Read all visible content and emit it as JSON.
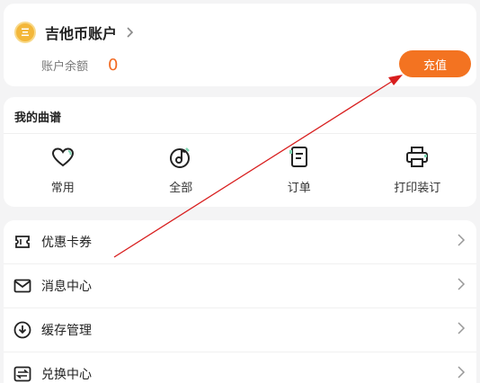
{
  "account": {
    "title": "吉他币账户",
    "balance_label": "账户余额",
    "balance_value": "0",
    "recharge_label": "充值",
    "coin_icon": "guitar-coin-icon",
    "accent_color": "#f37321"
  },
  "my_scores": {
    "title": "我的曲谱",
    "items": [
      {
        "label": "常用",
        "icon": "heart-icon"
      },
      {
        "label": "全部",
        "icon": "music-note-icon"
      },
      {
        "label": "订单",
        "icon": "order-icon"
      },
      {
        "label": "打印装订",
        "icon": "printer-icon"
      }
    ]
  },
  "menu": {
    "items": [
      {
        "label": "优惠卡券",
        "icon": "coupon-icon"
      },
      {
        "label": "消息中心",
        "icon": "mail-icon"
      },
      {
        "label": "缓存管理",
        "icon": "download-icon"
      },
      {
        "label": "兑换中心",
        "icon": "exchange-icon"
      }
    ]
  }
}
